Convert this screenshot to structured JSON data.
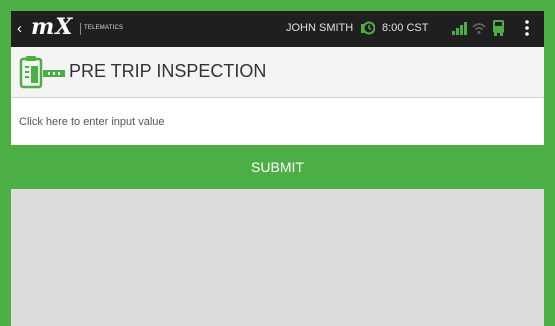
{
  "statusbar": {
    "back_chevron": "‹",
    "logo": "mX",
    "logo_sub": "TELEMATICS",
    "user_name": "JOHN SMITH",
    "time": "8:00 CST",
    "icons": [
      "clock-icon",
      "signal-icon",
      "wifi-icon",
      "truck-icon",
      "menu-icon"
    ]
  },
  "header": {
    "title": "PRE TRIP INSPECTION",
    "icon": "clipboard-icon"
  },
  "form": {
    "input_placeholder": "Click here to enter input value",
    "input_value": "",
    "submit_label": "SUBMIT"
  },
  "colors": {
    "accent": "#4caf45",
    "statusbar_bg": "#1f1f1f",
    "content_bg": "#dcdcdc"
  }
}
